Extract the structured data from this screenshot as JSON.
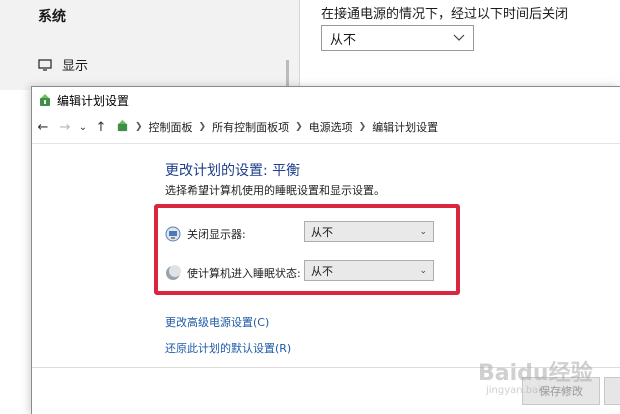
{
  "background_window": {
    "sidebar_title": "系统",
    "display_item": "显示",
    "main_text": "在接通电源的情况下，经过以下时间后关闭",
    "select_value": "从不"
  },
  "window": {
    "title": "编辑计划设置",
    "breadcrumbs": [
      "控制面板",
      "所有控制面板项",
      "电源选项",
      "编辑计划设置"
    ],
    "heading": "更改计划的设置: 平衡",
    "subtext": "选择希望计算机使用的睡眠设置和显示设置。",
    "settings": [
      {
        "label": "关闭显示器:",
        "value": "从不",
        "icon": "monitor-power-icon"
      },
      {
        "label": "使计算机进入睡眠状态:",
        "value": "从不",
        "icon": "sleep-moon-icon"
      }
    ],
    "links": {
      "advanced": "更改高级电源设置(C)",
      "restore": "还原此计划的默认设置(R)"
    },
    "save_label": "保存修改"
  },
  "watermark": {
    "text": "Baidu经验",
    "sub": "jingyan.baidu.com"
  },
  "colors": {
    "highlight": "#d7263d",
    "heading": "#1e3f8a",
    "link": "#1e5aa8"
  }
}
